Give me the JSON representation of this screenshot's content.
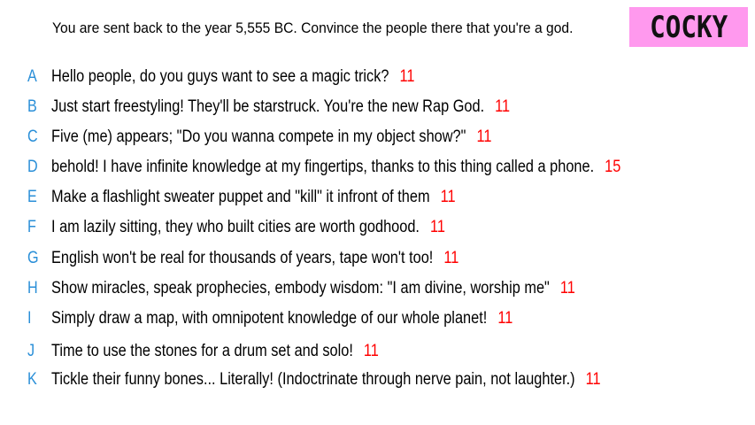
{
  "prompt": "You are sent back to the year 5,555 BC. Convince the people there that you're a god.",
  "category": "COCKY",
  "colors": {
    "badge": "#ff99ee",
    "letter": "#2a8fd8",
    "score": "#ff0000"
  },
  "answers": [
    {
      "letter": "A",
      "text": "Hello people, do you guys want to see a magic trick?",
      "score": "11"
    },
    {
      "letter": "B",
      "text": "Just start freestyling! They'll be starstruck. You're the new Rap God.",
      "score": "11"
    },
    {
      "letter": "C",
      "text": "Five (me) appears; \"Do you wanna compete in my object show?\"",
      "score": "11"
    },
    {
      "letter": "D",
      "text": "behold! I have infinite knowledge at my fingertips, thanks to this thing called a phone.",
      "score": "15"
    },
    {
      "letter": "E",
      "text": "Make a flashlight sweater puppet and \"kill\" it infront of them",
      "score": "11"
    },
    {
      "letter": "F",
      "text": "I am lazily sitting, they who built cities are worth godhood.",
      "score": "11"
    },
    {
      "letter": "G",
      "text": "English won't be real for thousands of years, tape won't too!",
      "score": "11"
    },
    {
      "letter": "H",
      "text": "Show miracles, speak prophecies, embody wisdom: \"I am divine, worship me\"",
      "score": "11"
    },
    {
      "letter": "I",
      "text": "Simply draw a map, with omnipotent knowledge of our whole planet!",
      "score": "11"
    },
    {
      "letter": "J",
      "text": "Time to use the stones for a drum set and solo!",
      "score": "11"
    },
    {
      "letter": "K",
      "text": "Tickle their funny bones... Literally! (Indoctrinate through nerve pain, not laughter.)",
      "score": "11"
    }
  ]
}
